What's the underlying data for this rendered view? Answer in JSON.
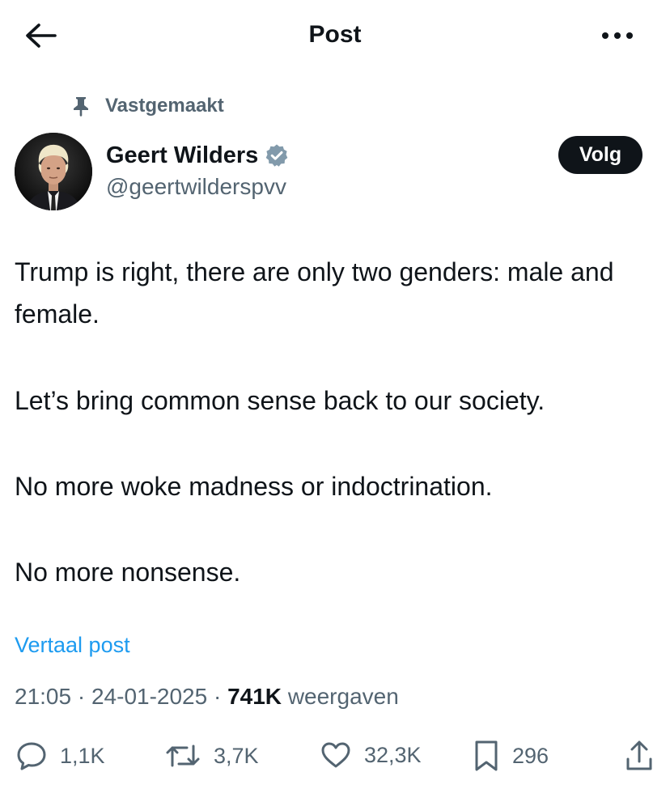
{
  "header": {
    "title": "Post",
    "back_icon": "arrow-left-icon",
    "more_icon": "more-horizontal-icon"
  },
  "post": {
    "pinned_label": "Vastgemaakt",
    "author_name": "Geert Wilders",
    "author_handle": "@geertwilderspvv",
    "verified": true,
    "follow_label": "Volg",
    "paragraphs": [
      "Trump is right, there are only two genders: male and female.",
      "Let’s bring common sense back to our society.",
      "No more woke madness or indoctrination.",
      "No more nonsense."
    ],
    "translate_label": "Vertaal post",
    "time": "21:05",
    "date": "24-01-2025",
    "views_count": "741K",
    "views_label": "weergaven"
  },
  "actions": {
    "replies": "1,1K",
    "reposts": "3,7K",
    "likes": "32,3K",
    "bookmarks": "296"
  },
  "colors": {
    "text": "#0f1419",
    "secondary": "#536471",
    "link": "#1d9bf0",
    "follow_bg": "#0f1419"
  }
}
